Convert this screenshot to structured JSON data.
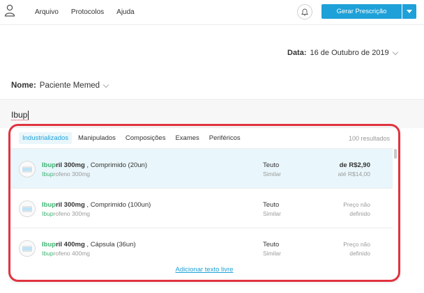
{
  "topbar": {
    "nav": [
      "Arquivo",
      "Protocolos",
      "Ajuda"
    ],
    "gerar_label": "Gerar Prescrição"
  },
  "form": {
    "date_label": "Data:",
    "date_value": "16 de Outubro de 2019",
    "nome_label": "Nome:",
    "nome_value": "Paciente Memed",
    "search_value": "Ibup"
  },
  "results": {
    "tabs": [
      "Industrializados",
      "Manipulados",
      "Composições",
      "Exames",
      "Periféricos"
    ],
    "active_tab": "Industrializados",
    "count": "100 resultados",
    "items": [
      {
        "name_hl": "Ibup",
        "name_rest": "ril 300mg",
        "name_desc": " , Comprimido (20un)",
        "sub_hl": "Ibup",
        "sub_rest": "rofeno 300mg",
        "lab": "Teuto",
        "lab_type": "Similar",
        "price": "de R$2,90",
        "price_sub": "até R$14,00"
      },
      {
        "name_hl": "Ibup",
        "name_rest": "ril 300mg",
        "name_desc": " , Comprimido (100un)",
        "sub_hl": "Ibup",
        "sub_rest": "rofeno 300mg",
        "lab": "Teuto",
        "lab_type": "Similar",
        "price": "Preço não",
        "price_sub": "definido"
      },
      {
        "name_hl": "Ibup",
        "name_rest": "ril 400mg",
        "name_desc": " , Cápsula (36un)",
        "sub_hl": "Ibup",
        "sub_rest": "rofeno 400mg",
        "lab": "Teuto",
        "lab_type": "Similar",
        "price": "Preço não",
        "price_sub": "definido"
      }
    ],
    "add_free_text": "Adicionar texto livre"
  }
}
